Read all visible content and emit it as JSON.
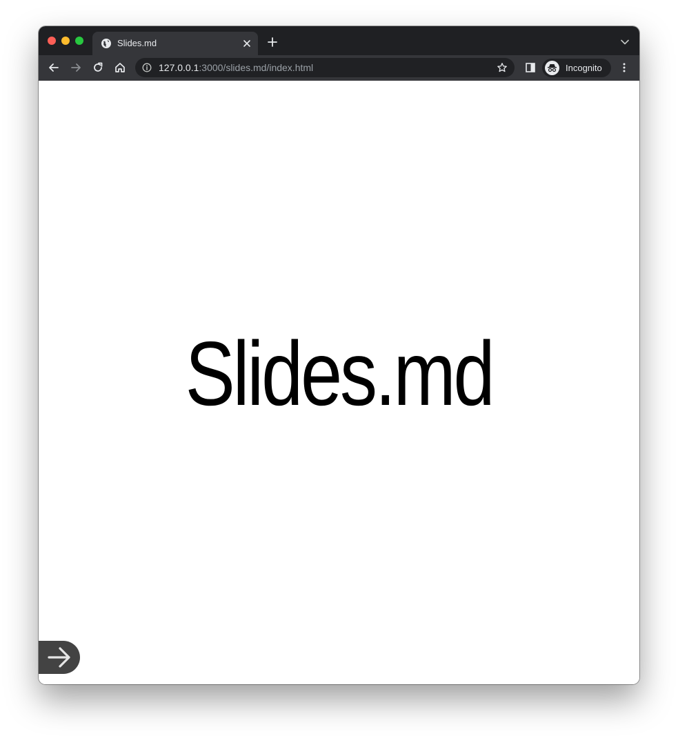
{
  "browser": {
    "tab": {
      "title": "Slides.md",
      "favicon": "globe-icon"
    },
    "address_bar": {
      "host": "127.0.0.1",
      "rest": ":3000/slides.md/index.html"
    },
    "profile": {
      "label": "Incognito",
      "icon": "incognito-icon"
    },
    "colors": {
      "titlebar": "#1f2023",
      "toolbar": "#35363a",
      "omnibox": "#202124"
    }
  },
  "slide": {
    "title": "Slides.md",
    "next_icon": "arrow-right-icon",
    "next_button_color": "#434343"
  }
}
